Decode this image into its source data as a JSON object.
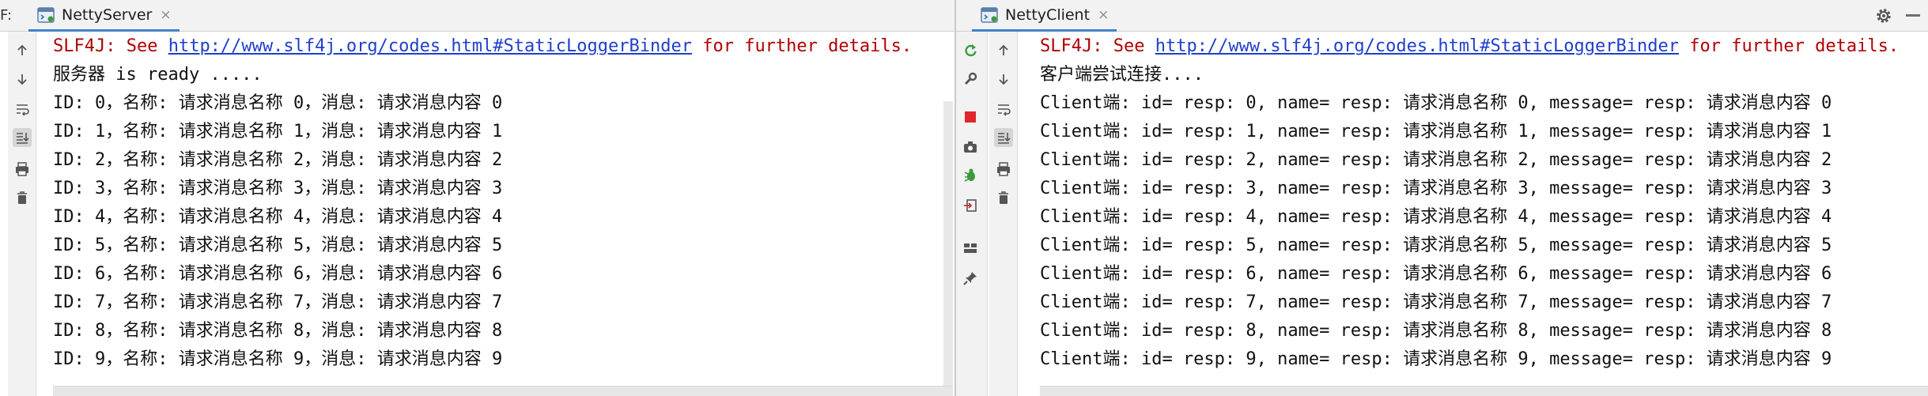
{
  "left": {
    "tabbar_prefix": "F:",
    "tab": {
      "title": "NettyServer",
      "close": "×",
      "icon": "console-tab-icon"
    },
    "toolbar": [
      {
        "name": "scroll-up-icon"
      },
      {
        "name": "scroll-down-icon"
      },
      {
        "name": "soft-wrap-icon"
      },
      {
        "name": "scroll-to-end-icon"
      },
      {
        "name": "print-icon"
      },
      {
        "name": "clear-all-icon"
      }
    ],
    "slf4j": {
      "prefix": "SLF4J: See ",
      "link": "http://www.slf4j.org/codes.html#StaticLoggerBinder",
      "suffix": " for further details."
    },
    "lines": [
      "服务器 is ready .....",
      "ID: 0，名称: 请求消息名称 0，消息: 请求消息内容 0",
      "ID: 1，名称: 请求消息名称 1，消息: 请求消息内容 1",
      "ID: 2，名称: 请求消息名称 2，消息: 请求消息内容 2",
      "ID: 3，名称: 请求消息名称 3，消息: 请求消息内容 3",
      "ID: 4，名称: 请求消息名称 4，消息: 请求消息内容 4",
      "ID: 5，名称: 请求消息名称 5，消息: 请求消息内容 5",
      "ID: 6，名称: 请求消息名称 6，消息: 请求消息内容 6",
      "ID: 7，名称: 请求消息名称 7，消息: 请求消息内容 7",
      "ID: 8，名称: 请求消息名称 8，消息: 请求消息内容 8",
      "ID: 9，名称: 请求消息名称 9，消息: 请求消息内容 9"
    ]
  },
  "right": {
    "tab": {
      "title": "NettyClient",
      "close": "×",
      "icon": "console-tab-icon"
    },
    "toolbar_run": [
      {
        "name": "rerun-icon"
      },
      {
        "name": "settings-wrench-icon"
      },
      {
        "name": "stop-icon"
      },
      {
        "name": "camera-icon"
      },
      {
        "name": "debug-bug-icon"
      },
      {
        "name": "exit-icon"
      },
      {
        "name": "layout-icon"
      },
      {
        "name": "pin-icon"
      }
    ],
    "toolbar": [
      {
        "name": "scroll-up-icon"
      },
      {
        "name": "scroll-down-icon"
      },
      {
        "name": "soft-wrap-icon"
      },
      {
        "name": "scroll-to-end-icon"
      },
      {
        "name": "print-icon"
      },
      {
        "name": "clear-all-icon"
      }
    ],
    "slf4j": {
      "prefix": "SLF4J: See ",
      "link": "http://www.slf4j.org/codes.html#StaticLoggerBinder",
      "suffix": " for further details."
    },
    "lines": [
      "客户端尝试连接....",
      "Client端: id= resp: 0, name= resp: 请求消息名称 0, message= resp: 请求消息内容 0",
      "Client端: id= resp: 1, name= resp: 请求消息名称 1, message= resp: 请求消息内容 1",
      "Client端: id= resp: 2, name= resp: 请求消息名称 2, message= resp: 请求消息内容 2",
      "Client端: id= resp: 3, name= resp: 请求消息名称 3, message= resp: 请求消息内容 3",
      "Client端: id= resp: 4, name= resp: 请求消息名称 4, message= resp: 请求消息内容 4",
      "Client端: id= resp: 5, name= resp: 请求消息名称 5, message= resp: 请求消息内容 5",
      "Client端: id= resp: 6, name= resp: 请求消息名称 6, message= resp: 请求消息内容 6",
      "Client端: id= resp: 7, name= resp: 请求消息名称 7, message= resp: 请求消息内容 7",
      "Client端: id= resp: 8, name= resp: 请求消息名称 8, message= resp: 请求消息内容 8",
      "Client端: id= resp: 9, name= resp: 请求消息名称 9, message= resp: 请求消息内容 9"
    ],
    "gear_icon": "gear-icon",
    "minimize_icon": "minimize-icon"
  },
  "colors": {
    "slf4j_text": "#b00000",
    "link": "#1f3fcc",
    "tab_underline": "#4083c9",
    "stop": "#e0262b",
    "rerun": "#3c9a3c"
  }
}
